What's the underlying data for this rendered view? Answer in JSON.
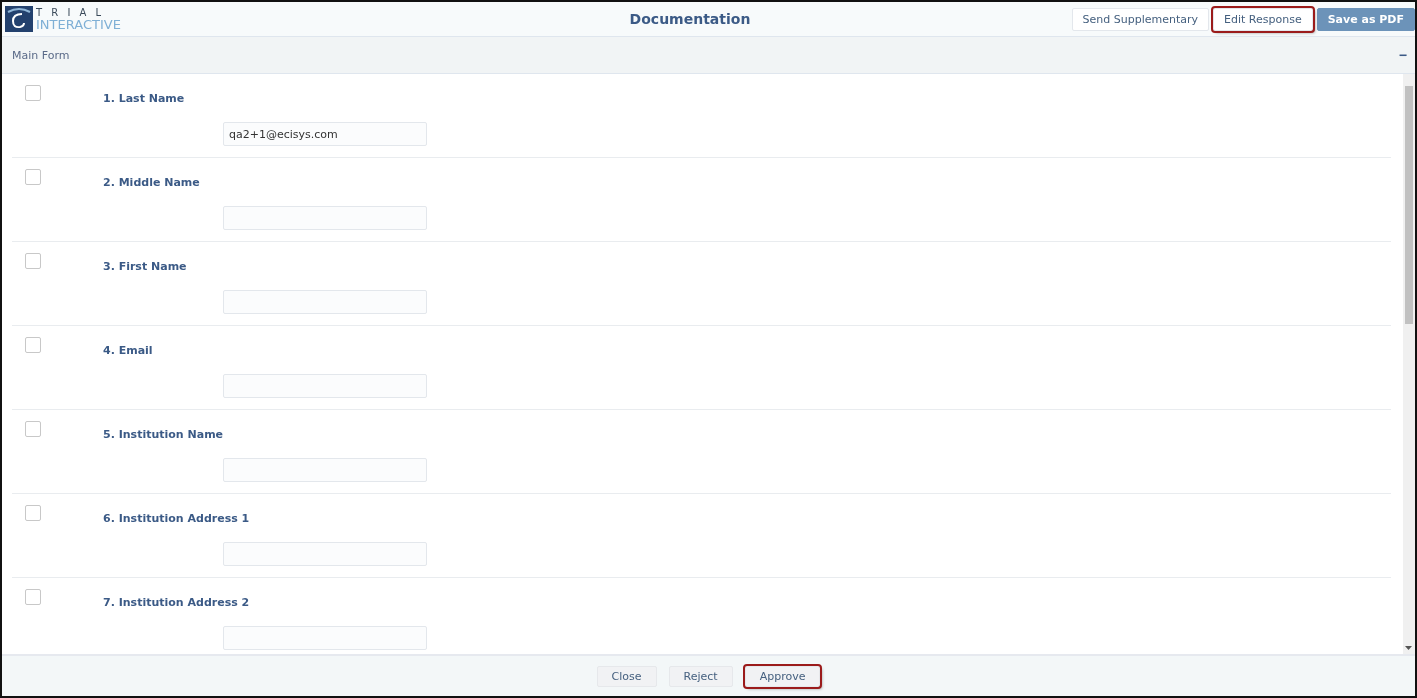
{
  "logo": {
    "top": "T R I A L",
    "bottom": "INTERACTIVE"
  },
  "window": {
    "title": "Documentation"
  },
  "header_buttons": [
    {
      "label": "Send Supplementary",
      "kind": "plain",
      "highlighted": false
    },
    {
      "label": "Edit Response",
      "kind": "plain",
      "highlighted": true
    },
    {
      "label": "Save as PDF",
      "kind": "primary",
      "highlighted": false
    }
  ],
  "section": {
    "title": "Main Form",
    "collapse_icon": "−"
  },
  "fields": [
    {
      "label": "1. Last Name",
      "value": "qa2+1@ecisys.com",
      "checked": false
    },
    {
      "label": "2. Middle Name",
      "checked": false
    },
    {
      "label": "3. First Name",
      "checked": false
    },
    {
      "label": "4. Email",
      "checked": false
    },
    {
      "label": "5. Institution Name",
      "checked": false
    },
    {
      "label": "6. Institution Address 1",
      "checked": false
    },
    {
      "label": "7. Institution Address 2",
      "checked": false
    }
  ],
  "footer_buttons": [
    {
      "label": "Close",
      "highlighted": false
    },
    {
      "label": "Reject",
      "highlighted": false
    },
    {
      "label": "Approve",
      "highlighted": true
    }
  ]
}
